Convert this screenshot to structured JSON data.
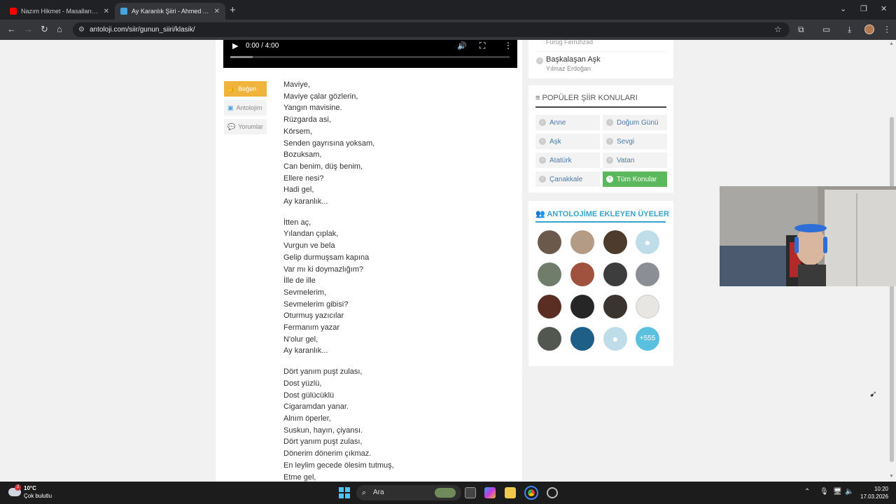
{
  "browser": {
    "tabs": [
      {
        "title": "Nazım Hikmet - Masalların Ma...",
        "favicon_color": "#ff0000"
      },
      {
        "title": "Ay Karanlık Şiiri - Ahmed Arif",
        "favicon_color": "#4aa3df"
      }
    ],
    "url": "antoloji.com/siir/gunun_siiri/klasik/",
    "icons": [
      "back-icon",
      "forward-icon",
      "reload-icon",
      "home-icon",
      "star-icon",
      "extensions-icon",
      "download-icon",
      "menu-icon"
    ]
  },
  "audio": {
    "time": "0:00 / 4:00",
    "buffered_fraction": 0.08
  },
  "side_buttons": {
    "like": "Beğen",
    "antolojim": "Antolojim",
    "comments": "Yorumlar"
  },
  "poem": {
    "stanzas": [
      [
        "Maviye,",
        "Maviye çalar gözlerin,",
        "Yangın mavisine.",
        "Rüzgarda asi,",
        "Körsem,",
        "Senden gayrısına yoksam,",
        "Bozuksam,",
        "Can benim, düş benim,",
        "Ellere nesi?",
        "Hadi gel,",
        "Ay karanlık..."
      ],
      [
        "İtten aç,",
        "Yılandan çıplak,",
        "Vurgun ve bela",
        "Gelip durmuşsam kapına",
        "Var mı ki doymazlığım?",
        "İlle de ille",
        "Sevmelerim,",
        "Sevmelerim gibisi?",
        "Oturmuş yazıcılar",
        "Fermanım yazar",
        "N'olur gel,",
        "Ay karanlık..."
      ],
      [
        "Dört yanım puşt zulası,",
        "Dost yüzlü,",
        "Dost gülücüklü",
        "Cigaramdan yanar.",
        "Alnım öperler,",
        "Suskun, hayın, çiyansı.",
        "Dört yanım puşt zulası,",
        "Dönerim dönerim çıkmaz.",
        "En leylim gecede ölesim tutmuş,",
        "Etme gel,"
      ]
    ]
  },
  "related": {
    "faded_author": "Furug Ferruhzad",
    "title": "Başkalaşan Aşk",
    "author": "Yılmaz Erdoğan"
  },
  "popular_topics": {
    "title": "POPÜLER ŞİİR KONULARI",
    "items": [
      "Anne",
      "Doğum Günü",
      "Aşk",
      "Sevgi",
      "Atatürk",
      "Vatan",
      "Çanakkale"
    ],
    "all_label": "Tüm Konular"
  },
  "members": {
    "title": "ANTOLOJİME EKLEYEN ÜYELER",
    "more_label": "+555"
  },
  "taskbar": {
    "temperature": "10°C",
    "condition": "Çok bulutlu",
    "weather_badge": "2",
    "search_placeholder": "Ara",
    "time": "10:20",
    "date": "17.03.2026"
  }
}
